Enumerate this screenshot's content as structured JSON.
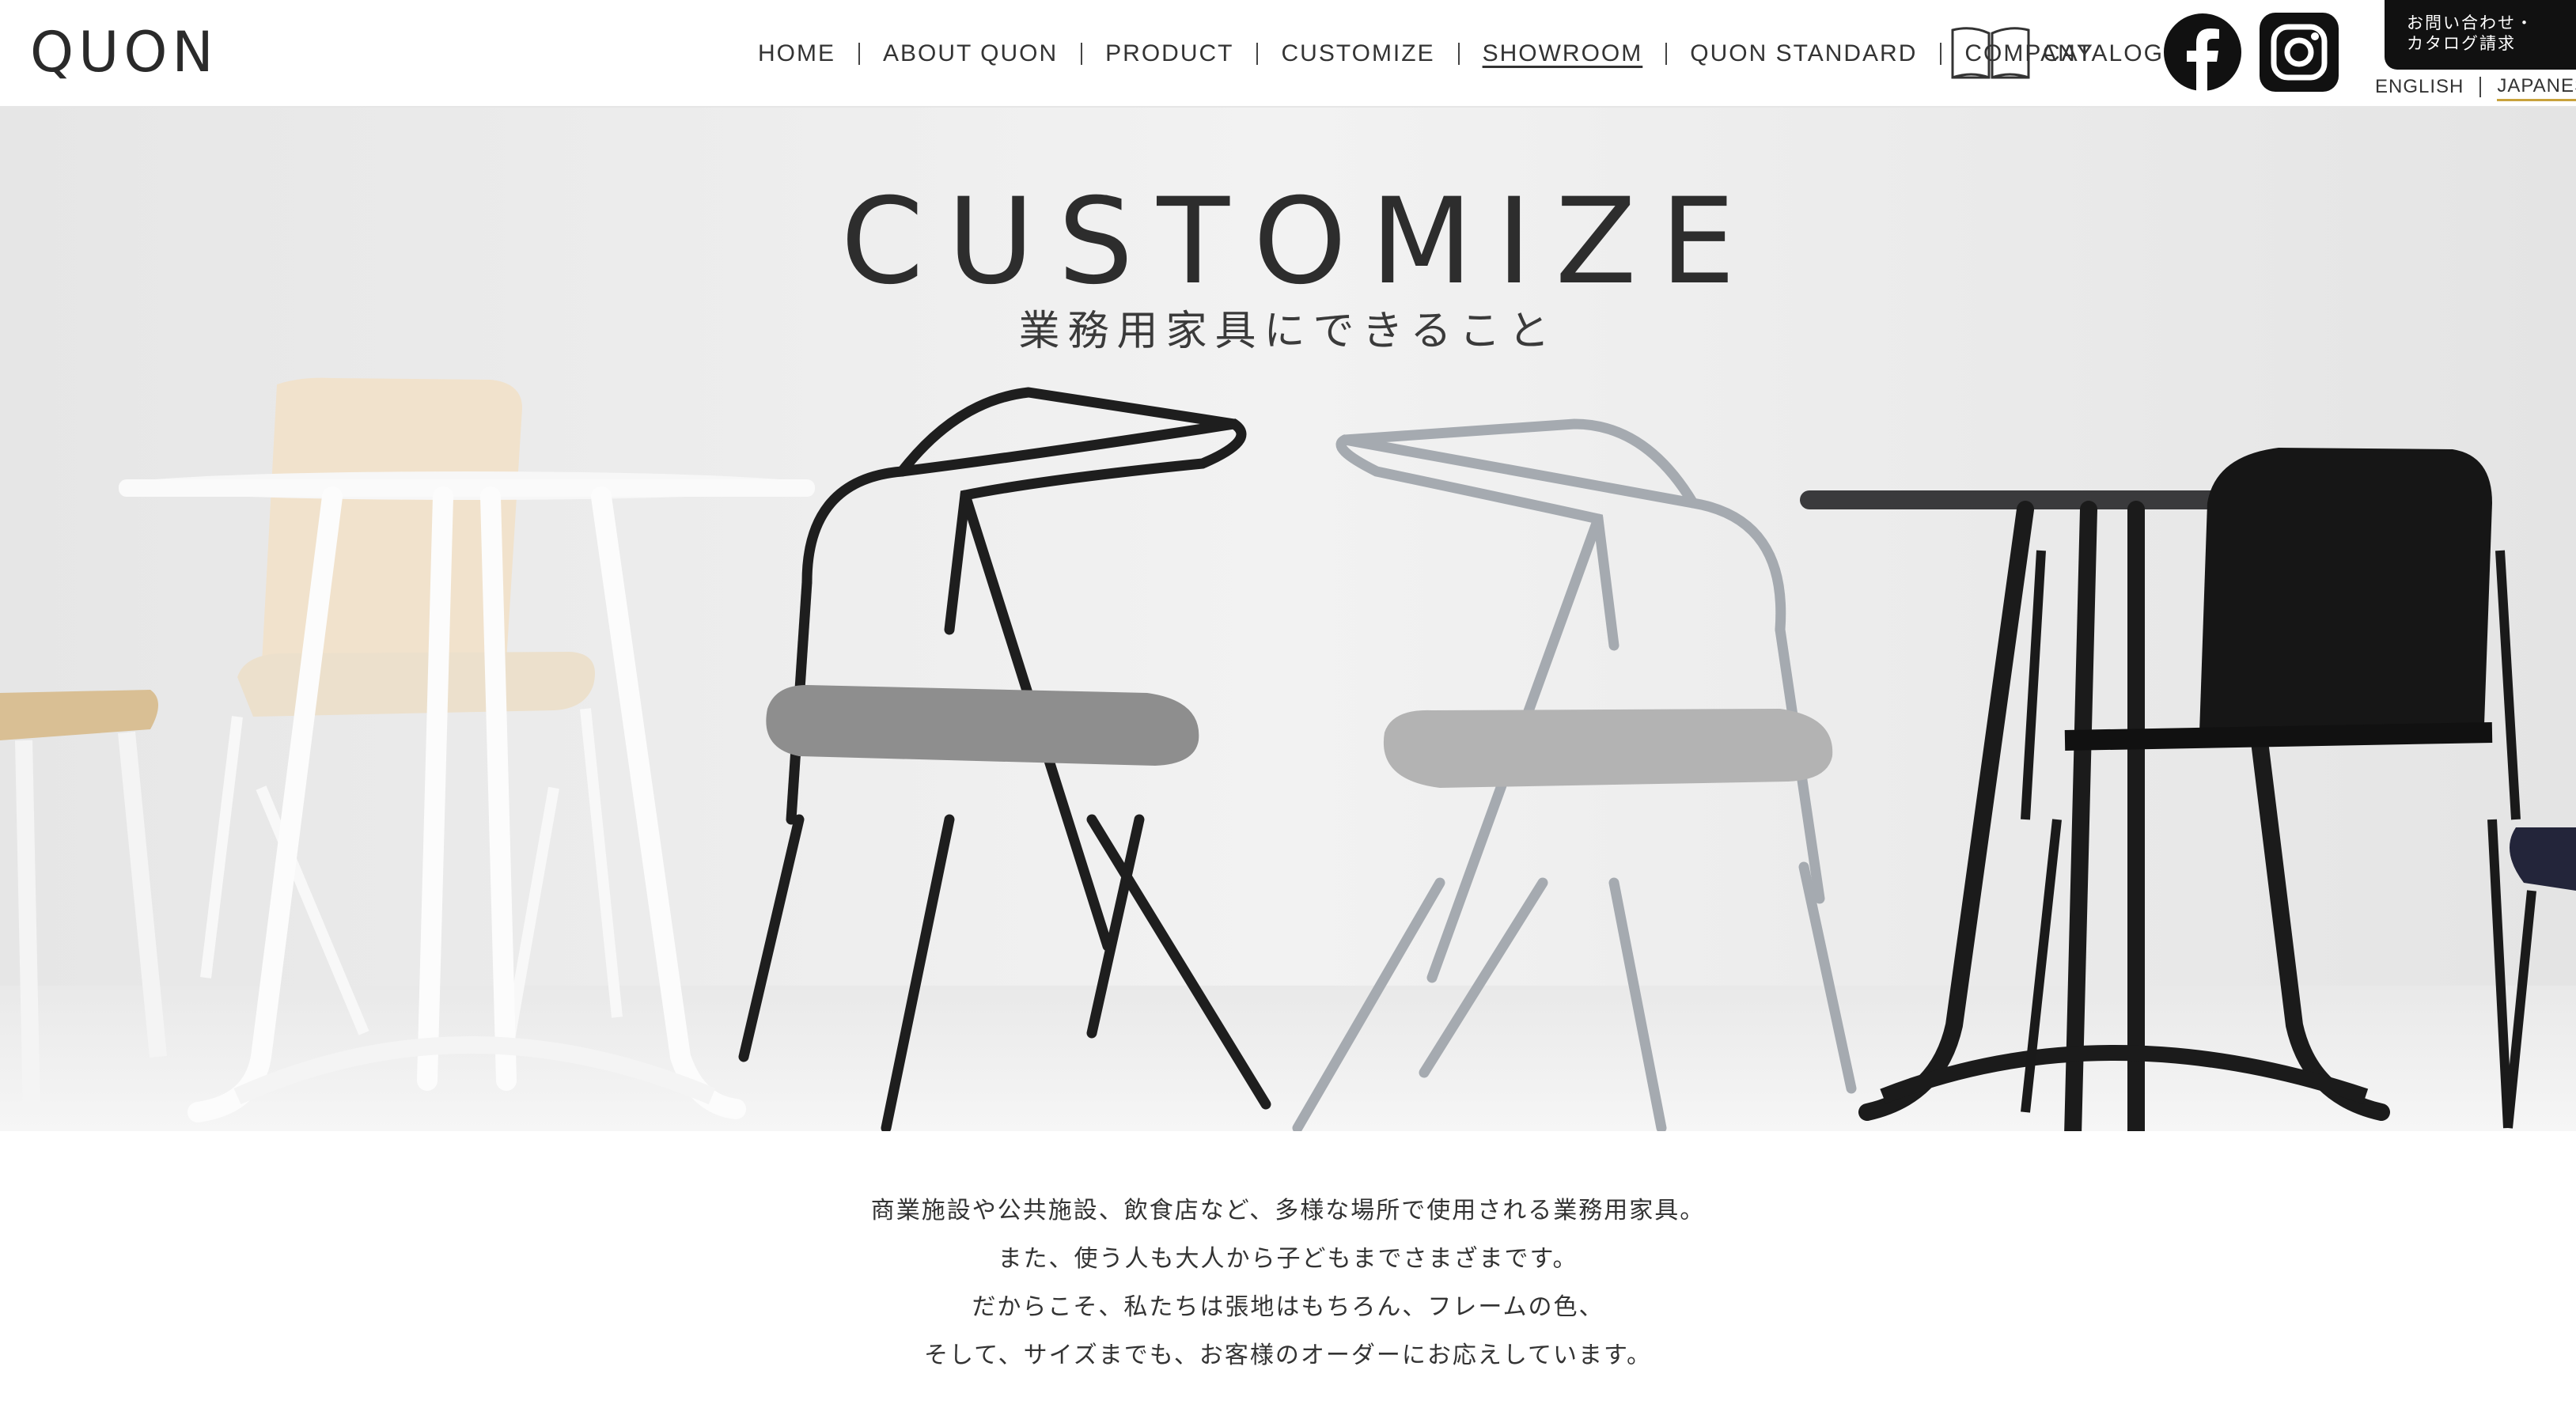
{
  "header": {
    "logo": "QUON",
    "nav": [
      {
        "label": "HOME"
      },
      {
        "label": "ABOUT QUON"
      },
      {
        "label": "PRODUCT"
      },
      {
        "label": "CUSTOMIZE"
      },
      {
        "label": "SHOWROOM",
        "active": true
      },
      {
        "label": "QUON STANDARD"
      },
      {
        "label": "COMPANY"
      }
    ],
    "catalog_label": "CATALOG",
    "social": [
      "facebook-icon",
      "instagram-icon"
    ],
    "contact_lines": [
      "お問い合わせ・",
      "カタログ請求"
    ],
    "languages": [
      {
        "label": "ENGLISH"
      },
      {
        "label": "JAPANESE",
        "current": true
      }
    ]
  },
  "hero": {
    "title": "CUSTOMIZE",
    "subtitle": "業務用家具にできること"
  },
  "intro": {
    "lines": [
      "商業施設や公共施設、飲食店など、多様な場所で使用される業務用家具。",
      "また、使う人も大人から子どもまでさまざまです。",
      "だからこそ、私たちは張地はもちろん、フレームの色、",
      "そして、サイズまでも、お客様のオーダーにお応えしています。"
    ]
  },
  "colors": {
    "accent_underline": "#c8a23c",
    "contact_bg": "#111111",
    "hero_bg": "#ededed"
  }
}
